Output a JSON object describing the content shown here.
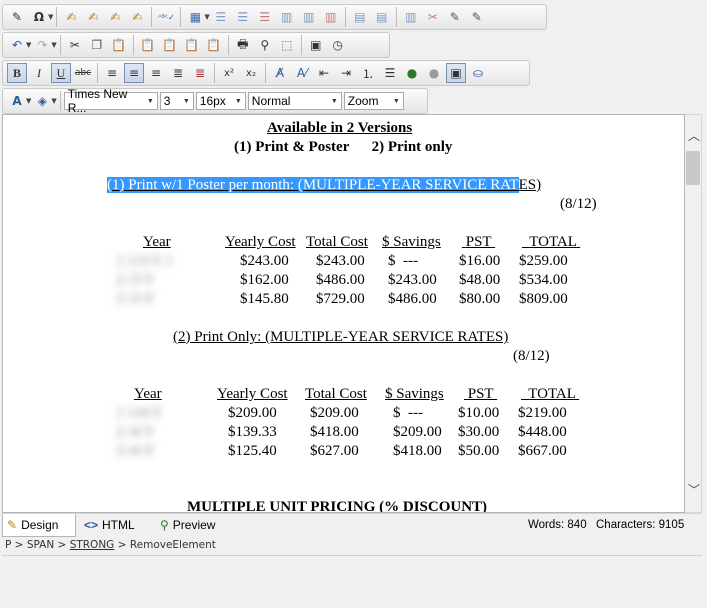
{
  "toolbar": {
    "row1_icons": [
      "edit-icon",
      "omega-icon",
      "paint-icon",
      "paint-icon",
      "paint-icon",
      "paint-icon",
      "spellcheck-icon",
      "table-icon",
      "grid-icon",
      "grid-icon",
      "grid-icon",
      "grid-icon",
      "grid-icon",
      "grid-icon",
      "grid-icon",
      "grid-icon",
      "grid-icon",
      "grid-icon",
      "grid-icon",
      "edit-icon"
    ],
    "row2_icons": [
      "undo-icon",
      "redo-icon",
      "cut-icon",
      "copy-icon",
      "paste-icon",
      "paste-word-icon",
      "paste-text-icon",
      "paste-icon",
      "paste-icon",
      "print-icon",
      "find-icon",
      "select-all-icon",
      "template-icon",
      "clock-icon"
    ],
    "bold": "B",
    "italic": "I",
    "underline": "U",
    "strike": "abc",
    "superscript": "x²",
    "subscript": "x₂",
    "font_name": "Times New R...",
    "font_size_num": "3",
    "font_size_px": "16px",
    "paragraph_style": "Normal",
    "zoom": "Zoom"
  },
  "doc": {
    "title": "Available in 2 Versions",
    "versions": "(1) Print & Poster      2) Print only",
    "sec1_heading_selected": "(1) Print w/1 Poster per month: (MULTIPLE-YEAR SERVICE RAT",
    "sec1_heading_rest": "ES)",
    "sec1_date": "(8/12)",
    "headers": [
      "Year",
      "Yearly Cost",
      "Total Cost",
      "$ Savings",
      "PST",
      "TOTAL"
    ],
    "table1": [
      {
        "year": "1 1/3-Y 1",
        "yearly": "$243.00",
        "total": "$243.00",
        "savings": "$  ---",
        "pst": "$16.00",
        "grand": "$259.00"
      },
      {
        "year": "2 /3-Y",
        "yearly": "$162.00",
        "total": "$486.00",
        "savings": "$243.00",
        "pst": "$48.00",
        "grand": "$534.00"
      },
      {
        "year": "3 /3-Y",
        "yearly": "$145.80",
        "total": "$729.00",
        "savings": "$486.00",
        "pst": "$80.00",
        "grand": "$809.00"
      }
    ],
    "sec2_heading": "(2) Print Only: (MULTIPLE-YEAR SERVICE RATES)",
    "sec2_date": "(8/12)",
    "table2": [
      {
        "year": "1 1/4-Y",
        "yearly": "$209.00",
        "total": "$209.00",
        "savings": "$  ---",
        "pst": "$10.00",
        "grand": "$219.00"
      },
      {
        "year": "2 /4-Y",
        "yearly": "$139.33",
        "total": "$418.00",
        "savings": "$209.00",
        "pst": "$30.00",
        "grand": "$448.00"
      },
      {
        "year": "3 /4-Y",
        "yearly": "$125.40",
        "total": "$627.00",
        "savings": "$418.00",
        "pst": "$50.00",
        "grand": "$667.00"
      }
    ],
    "sec3_heading": "MULTIPLE UNIT PRICING (% DISCOUNT)"
  },
  "modes": {
    "design": "Design",
    "html": "HTML",
    "preview": "Preview"
  },
  "stats": {
    "words": "Words: 840",
    "chars": "Characters: 9105"
  },
  "path": {
    "p": "P",
    "span": "SPAN",
    "strong": "STRONG",
    "remove": "RemoveElement",
    "sep": " > "
  },
  "colors": {
    "selection": "#3399ff",
    "active_button": "#c7d4e8"
  }
}
